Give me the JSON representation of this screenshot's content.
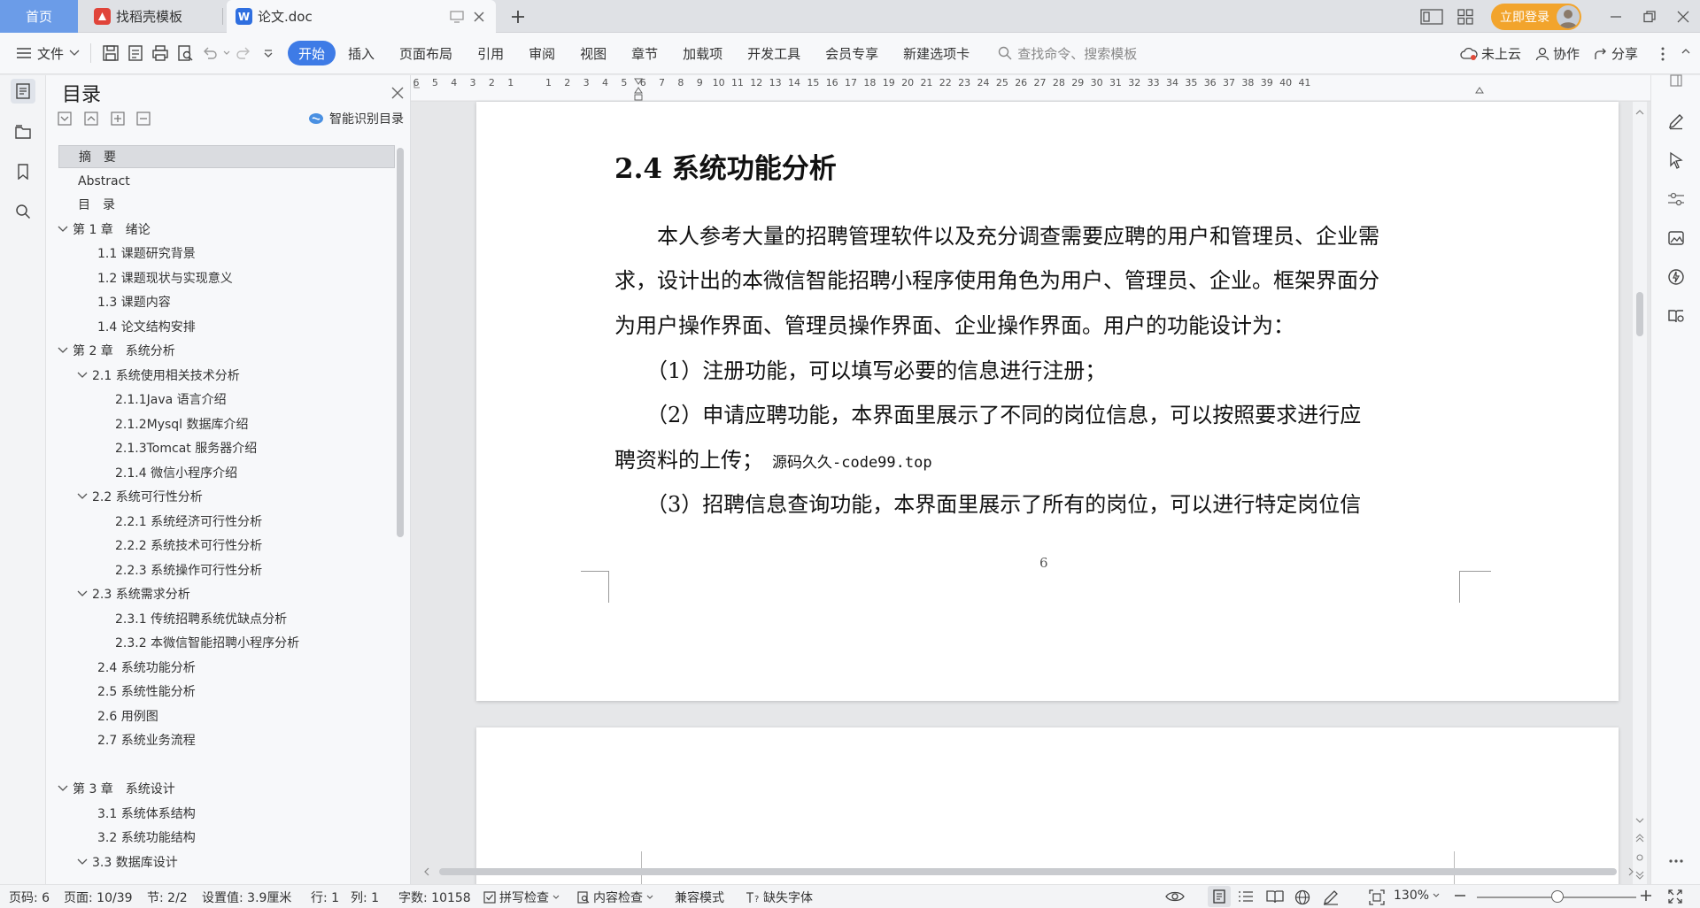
{
  "titlebar": {
    "tabs": [
      {
        "label": "首页"
      },
      {
        "label": "找稻壳模板"
      },
      {
        "label": "论文.doc"
      }
    ],
    "login_label": "立即登录"
  },
  "toolbar": {
    "file_label": "文件",
    "menu_tabs": [
      "开始",
      "插入",
      "页面布局",
      "引用",
      "审阅",
      "视图",
      "章节",
      "加载项",
      "开发工具",
      "会员专享",
      "新建选项卡"
    ],
    "search_placeholder": "查找命令、搜索模板",
    "cloud_label": "未上云",
    "collab_label": "协作",
    "share_label": "分享"
  },
  "outline": {
    "title": "目录",
    "smart_toc_label": "智能识别目录",
    "items": [
      {
        "label": "摘　要",
        "level": 1,
        "chevron": false,
        "active": true
      },
      {
        "label": "Abstract",
        "level": 1,
        "chevron": false
      },
      {
        "label": "目　录",
        "level": 1,
        "chevron": false
      },
      {
        "label": "第 1 章　绪论",
        "level": 1,
        "chevron": true
      },
      {
        "label": "1.1 课题研究背景",
        "level": 2,
        "chevron": false
      },
      {
        "label": "1.2 课题现状与实现意义",
        "level": 2,
        "chevron": false
      },
      {
        "label": "1.3 课题内容",
        "level": 2,
        "chevron": false
      },
      {
        "label": "1.4 论文结构安排",
        "level": 2,
        "chevron": false
      },
      {
        "label": "第 2 章　系统分析",
        "level": 1,
        "chevron": true
      },
      {
        "label": "2.1 系统使用相关技术分析",
        "level": 2,
        "chevron": true
      },
      {
        "label": "2.1.1Java 语言介绍",
        "level": 3,
        "chevron": false
      },
      {
        "label": "2.1.2Mysql 数据库介绍",
        "level": 3,
        "chevron": false
      },
      {
        "label": "2.1.3Tomcat 服务器介绍",
        "level": 3,
        "chevron": false
      },
      {
        "label": "2.1.4 微信小程序介绍",
        "level": 3,
        "chevron": false
      },
      {
        "label": "2.2 系统可行性分析",
        "level": 2,
        "chevron": true
      },
      {
        "label": "2.2.1 系统经济可行性分析",
        "level": 3,
        "chevron": false
      },
      {
        "label": "2.2.2 系统技术可行性分析",
        "level": 3,
        "chevron": false
      },
      {
        "label": "2.2.3 系统操作可行性分析",
        "level": 3,
        "chevron": false
      },
      {
        "label": "2.3 系统需求分析",
        "level": 2,
        "chevron": true
      },
      {
        "label": "2.3.1 传统招聘系统优缺点分析",
        "level": 3,
        "chevron": false
      },
      {
        "label": "2.3.2 本微信智能招聘小程序分析",
        "level": 3,
        "chevron": false
      },
      {
        "label": "2.4 系统功能分析",
        "level": 2,
        "chevron": false
      },
      {
        "label": "2.5 系统性能分析",
        "level": 2,
        "chevron": false
      },
      {
        "label": "2.6 用例图",
        "level": 2,
        "chevron": false
      },
      {
        "label": "2.7 系统业务流程",
        "level": 2,
        "chevron": false
      },
      {
        "label": "",
        "level": 2,
        "chevron": false
      },
      {
        "label": "第 3 章　系统设计",
        "level": 1,
        "chevron": true
      },
      {
        "label": "3.1 系统体系结构",
        "level": 2,
        "chevron": false
      },
      {
        "label": "3.2 系统功能结构",
        "level": 2,
        "chevron": false
      },
      {
        "label": "3.3 数据库设计",
        "level": 2,
        "chevron": true
      }
    ]
  },
  "ruler": {
    "numbers": [
      "6",
      "5",
      "4",
      "3",
      "2",
      "1",
      "",
      "1",
      "2",
      "3",
      "4",
      "5",
      "6",
      "7",
      "8",
      "9",
      "10",
      "11",
      "12",
      "13",
      "14",
      "15",
      "16",
      "17",
      "18",
      "19",
      "20",
      "21",
      "22",
      "23",
      "24",
      "25",
      "26",
      "27",
      "28",
      "29",
      "30",
      "31",
      "32",
      "33",
      "34",
      "35",
      "36",
      "37",
      "38",
      "39",
      "40",
      "41"
    ]
  },
  "document": {
    "heading": "2.4 系统功能分析",
    "lines": [
      "　　本人参考大量的招聘管理软件以及充分调查需要应聘的用户和管理员、企业需",
      "求，设计出的本微信智能招聘小程序使用角色为用户、管理员、企业。框架界面分",
      "为用户操作界面、管理员操作界面、企业操作界面。用户的功能设计为：",
      "　　（1）注册功能，可以填写必要的信息进行注册；",
      "　　（2）申请应聘功能，本界面里展示了不同的岗位信息，可以按照要求进行应",
      "聘资料的上传；",
      "　　（3）招聘信息查询功能，本界面里展示了所有的岗位，可以进行特定岗位信"
    ],
    "watermark": "源码久久-code99.top",
    "page_number": "6"
  },
  "status": {
    "page_code": "页码: 6",
    "page": "页面: 10/39",
    "section": "节: 2/2",
    "setting": "设置值: 3.9厘米",
    "row": "行: 1",
    "col": "列: 1",
    "words": "字数: 10158",
    "spell": "拼写检查",
    "content_check": "内容检查",
    "compat": "兼容模式",
    "missing_font": "缺失字体",
    "zoom": "130%"
  },
  "colors": {
    "accent": "#3e7be6",
    "home_tab": "#6b9ce8",
    "login": "#f2a42c"
  }
}
